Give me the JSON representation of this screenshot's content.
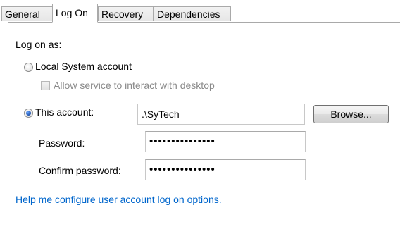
{
  "tabs": [
    {
      "label": "General"
    },
    {
      "label": "Log On"
    },
    {
      "label": "Recovery"
    },
    {
      "label": "Dependencies"
    }
  ],
  "logon": {
    "heading": "Log on as:",
    "local_system_label": "Local System account",
    "allow_interact_label": "Allow service to interact with desktop",
    "this_account_label": "This account:",
    "account_value": ".\\SyTech",
    "browse_label": "Browse...",
    "password_label": "Password:",
    "password_value": "•••••••••••••••",
    "confirm_label": "Confirm password:",
    "confirm_value": "•••••••••••••••",
    "help_link": "Help me configure user account log on options."
  },
  "state": {
    "selected_option": "This account",
    "allow_interact_checked": false,
    "allow_interact_enabled": false
  }
}
